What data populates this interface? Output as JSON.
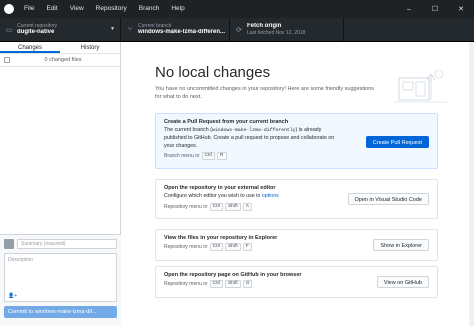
{
  "menu": [
    "File",
    "Edit",
    "View",
    "Repository",
    "Branch",
    "Help"
  ],
  "toolbar": {
    "repo_label": "Current repository",
    "repo_value": "dugite-native",
    "branch_label": "Current branch",
    "branch_value": "windows-make-lzma-differen...",
    "fetch_title": "Fetch origin",
    "fetch_sub": "Last fetched Nov 12, 2018"
  },
  "left": {
    "tabs": [
      "Changes",
      "History"
    ],
    "files_count": "0 changed files",
    "summary_placeholder": "Summary (required)",
    "description_placeholder": "Description",
    "commit_button": "Commit to windows-make-lzma-dif..."
  },
  "main": {
    "title": "No local changes",
    "subtitle": "You have no uncommitted changes in your repository! Here are some friendly suggestions for what to do next.",
    "cards": [
      {
        "title": "Create a Pull Request from your current branch",
        "desc_pre": "The current branch (",
        "desc_code": "windows-make-lzma-differently",
        "desc_post": ") is already published to GitHub. Create a pull request to propose and collaborate on your changes.",
        "shortcut_prefix": "Branch menu or",
        "keys": [
          "Ctrl",
          "R"
        ],
        "button": "Create Pull Request"
      },
      {
        "title": "Open the repository in your external editor",
        "desc_pre": "Configure which editor you wish to use in ",
        "desc_link": "options",
        "shortcut_prefix": "Repository menu or",
        "keys": [
          "Ctrl",
          "Shift",
          "A"
        ],
        "button": "Open in Visual Studio Code"
      },
      {
        "title": "View the files in your repository in Explorer",
        "shortcut_prefix": "Repository menu or",
        "keys": [
          "Ctrl",
          "Shift",
          "F"
        ],
        "button": "Show in Explorer"
      },
      {
        "title": "Open the repository page on GitHub in your browser",
        "shortcut_prefix": "Repository menu or",
        "keys": [
          "Ctrl",
          "Shift",
          "G"
        ],
        "button": "View on GitHub"
      }
    ]
  },
  "colors": {
    "accent": "#0366d6",
    "toolbar_bg": "#24292e",
    "menubar_bg": "#1e2225"
  }
}
